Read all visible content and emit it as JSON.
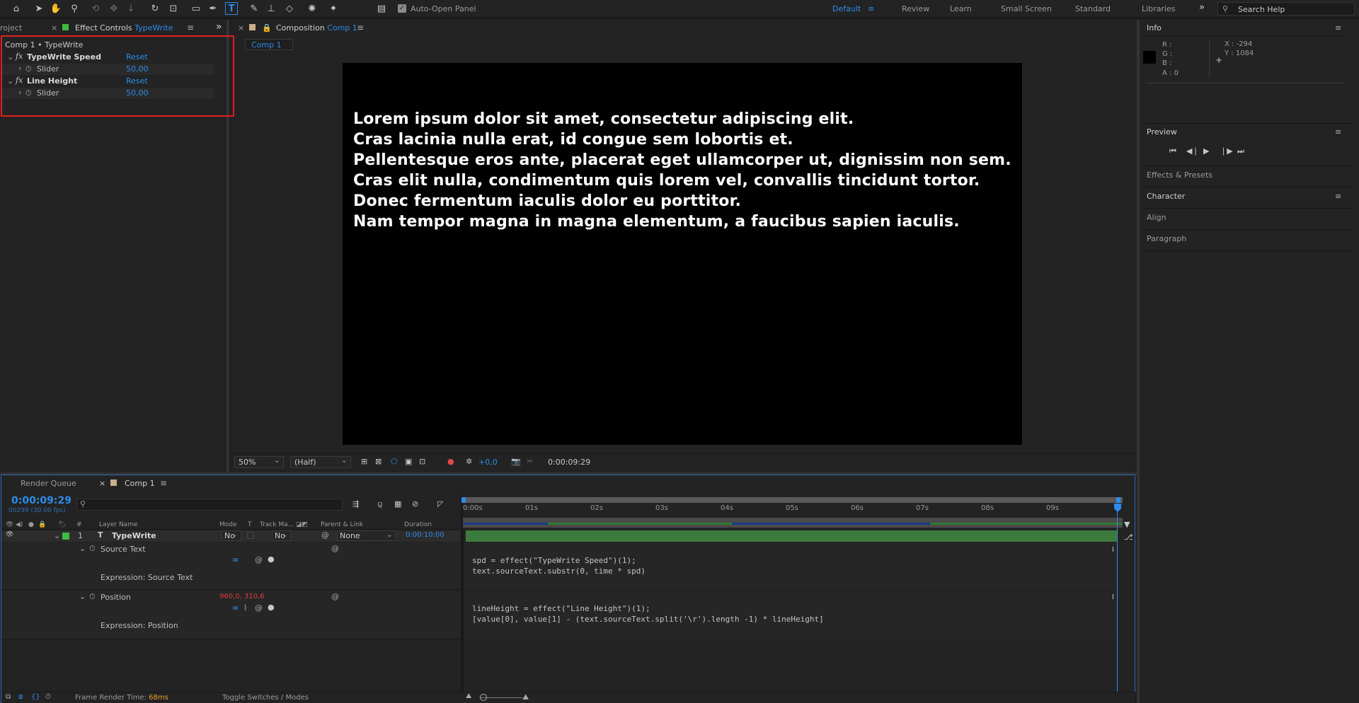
{
  "toolbar": {
    "auto_open_label": "Auto-Open Panel",
    "workspaces": [
      "Default",
      "Review",
      "Learn",
      "Small Screen",
      "Standard",
      "Libraries"
    ],
    "active_workspace": "Default",
    "more_label": "»",
    "search_placeholder": "Search Help"
  },
  "project_tab": {
    "label": "roject"
  },
  "effect_controls": {
    "tab_label": "Effect Controls",
    "tab_layer": "TypeWrite",
    "header": "Comp 1 • TypeWrite",
    "effects": [
      {
        "fx": "fx",
        "name": "TypeWrite Speed",
        "reset": "Reset",
        "param": "Slider",
        "value": "50,00"
      },
      {
        "fx": "fx",
        "name": "Line Height",
        "reset": "Reset",
        "param": "Slider",
        "value": "50,00"
      }
    ]
  },
  "composition": {
    "tab_prefix": "Composition",
    "tab_name": "Comp 1",
    "sub_tab": "Comp 1",
    "lines": [
      "Lorem ipsum dolor sit amet, consectetur adipiscing elit.",
      "Cras lacinia nulla erat, id congue sem lobortis et.",
      "Pellentesque eros ante, placerat eget ullamcorper ut, dignissim non sem.",
      "Cras elit nulla, condimentum quis lorem vel, convallis tincidunt tortor.",
      "Donec fermentum iaculis dolor eu porttitor.",
      "Nam tempor magna in magna elementum, a faucibus sapien iaculis."
    ],
    "zoom": "50%",
    "resolution": "(Half)",
    "exposure": "+0,0",
    "timecode": "0:00:09:29"
  },
  "info": {
    "title": "Info",
    "r": "R :",
    "g": "G :",
    "b": "B :",
    "a": "A :  0",
    "x": "X : -294",
    "y": "Y : 1084"
  },
  "right_panels": {
    "preview": "Preview",
    "effects_presets": "Effects & Presets",
    "character": "Character",
    "align": "Align",
    "paragraph": "Paragraph"
  },
  "timeline": {
    "render_queue": "Render Queue",
    "comp_tab": "Comp 1",
    "current_time": "0:00:09:29",
    "frame_info": "00299 (30.00 fps)",
    "columns": {
      "num": "#",
      "layer_name": "Layer Name",
      "mode": "Mode",
      "t": "T",
      "track_matte": "Track Ma...",
      "parent": "Parent & Link",
      "duration": "Duration"
    },
    "layer": {
      "index": "1",
      "name": "TypeWrite",
      "mode": "No",
      "track": "No",
      "parent": "None",
      "duration": "0:00:10:00"
    },
    "props": [
      {
        "name": "Source Text",
        "expr_label": "Expression: Source Text",
        "value": ""
      },
      {
        "name": "Position",
        "expr_label": "Expression: Position",
        "value": "960,0, 310,6"
      }
    ],
    "ticks": [
      "0:00s",
      "01s",
      "02s",
      "03s",
      "04s",
      "05s",
      "06s",
      "07s",
      "08s",
      "09s"
    ],
    "code1": [
      "spd = effect(\"TypeWrite Speed\")(1);",
      "text.sourceText.substr(0, time * spd)"
    ],
    "code2": [
      "lineHeight = effect(\"Line Height\")(1);",
      "[value[0], value[1] - (text.sourceText.split('\\r').length -1) * lineHeight]"
    ],
    "footer_render_label": "Frame Render Time:",
    "footer_render_value": "68ms",
    "toggle_label": "Toggle Switches / Modes"
  }
}
